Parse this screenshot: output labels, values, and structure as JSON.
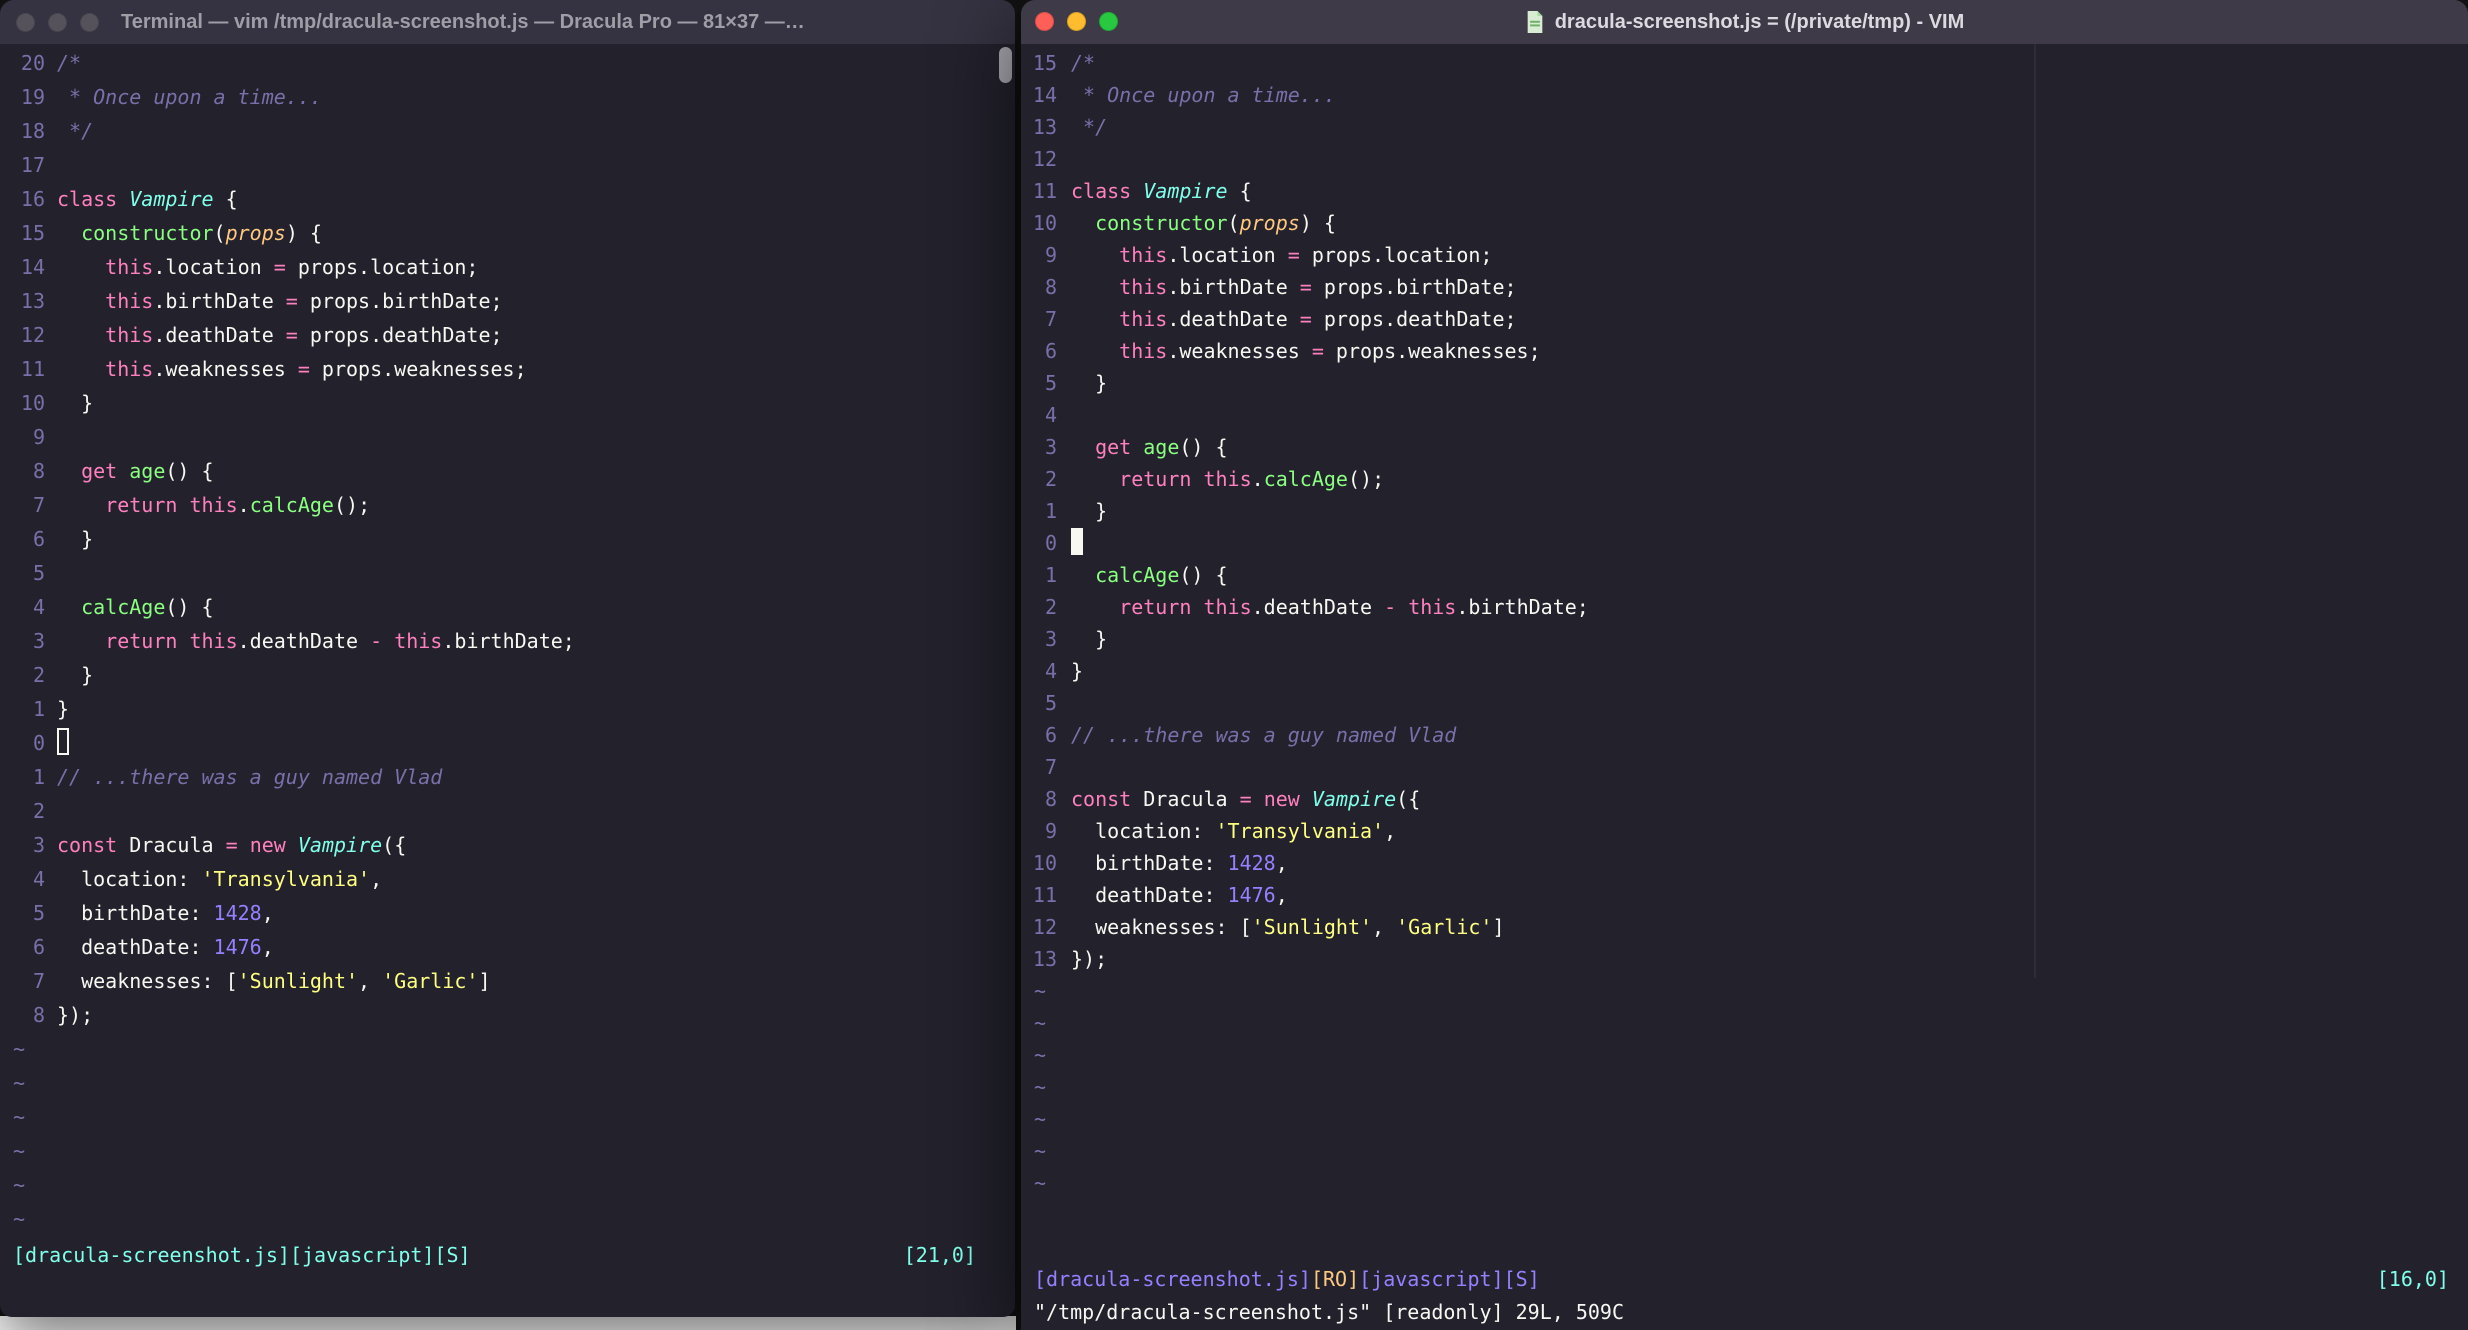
{
  "palette": {
    "bg": "#22212C",
    "fg": "#F8F8F2",
    "comment": "#7970A9",
    "linenr": "#7970A9",
    "pink": "#FF80BF",
    "green": "#8AFF80",
    "cyan": "#80FFEA",
    "orange": "#FFCA80",
    "purple": "#9580FF",
    "yellow": "#FFFF80",
    "titlebar_left": "#353241",
    "titlebar_right": "#3E3A47",
    "title_text_left": "#9F9DA6",
    "title_text_right": "#DCDAE0",
    "light_red": "#FF5F57",
    "light_yellow": "#FEBC2E",
    "light_green": "#28C840",
    "light_inactive": "#55525C"
  },
  "tilde_char": "~",
  "left_window": {
    "title": "Terminal — vim /tmp/dracula-screenshot.js — Dracula Pro — 81×37 —…",
    "status": {
      "left_text": "[dracula-screenshot.js][javascript][S]",
      "right_text": "[21,0]"
    },
    "cursor_line_index": 20,
    "cursor_style": "hollow",
    "tilde_count": 6,
    "lines": [
      {
        "n": "20",
        "t": [
          [
            "com",
            "/*"
          ]
        ]
      },
      {
        "n": "19",
        "t": [
          [
            "com",
            " * Once upon a time..."
          ]
        ]
      },
      {
        "n": "18",
        "t": [
          [
            "com",
            " */"
          ]
        ]
      },
      {
        "n": "17",
        "t": []
      },
      {
        "n": "16",
        "t": [
          [
            "kw",
            "class"
          ],
          [
            "fg",
            " "
          ],
          [
            "cls",
            "Vampire"
          ],
          [
            "fg",
            " {"
          ]
        ]
      },
      {
        "n": "15",
        "t": [
          [
            "fg",
            "  "
          ],
          [
            "fn",
            "constructor"
          ],
          [
            "fg",
            "("
          ],
          [
            "param",
            "props"
          ],
          [
            "fg",
            ") {"
          ]
        ]
      },
      {
        "n": "14",
        "t": [
          [
            "fg",
            "    "
          ],
          [
            "kw",
            "this"
          ],
          [
            "fg",
            ".location "
          ],
          [
            "op",
            "="
          ],
          [
            "fg",
            " props.location;"
          ]
        ]
      },
      {
        "n": "13",
        "t": [
          [
            "fg",
            "    "
          ],
          [
            "kw",
            "this"
          ],
          [
            "fg",
            ".birthDate "
          ],
          [
            "op",
            "="
          ],
          [
            "fg",
            " props.birthDate;"
          ]
        ]
      },
      {
        "n": "12",
        "t": [
          [
            "fg",
            "    "
          ],
          [
            "kw",
            "this"
          ],
          [
            "fg",
            ".deathDate "
          ],
          [
            "op",
            "="
          ],
          [
            "fg",
            " props.deathDate;"
          ]
        ]
      },
      {
        "n": "11",
        "t": [
          [
            "fg",
            "    "
          ],
          [
            "kw",
            "this"
          ],
          [
            "fg",
            ".weaknesses "
          ],
          [
            "op",
            "="
          ],
          [
            "fg",
            " props.weaknesses;"
          ]
        ]
      },
      {
        "n": "10",
        "t": [
          [
            "fg",
            "  }"
          ]
        ]
      },
      {
        "n": "9",
        "t": []
      },
      {
        "n": "8",
        "t": [
          [
            "fg",
            "  "
          ],
          [
            "kw",
            "get"
          ],
          [
            "fg",
            " "
          ],
          [
            "fn",
            "age"
          ],
          [
            "fg",
            "() {"
          ]
        ]
      },
      {
        "n": "7",
        "t": [
          [
            "fg",
            "    "
          ],
          [
            "kw",
            "return"
          ],
          [
            "fg",
            " "
          ],
          [
            "kw",
            "this"
          ],
          [
            "fg",
            "."
          ],
          [
            "fn",
            "calcAge"
          ],
          [
            "fg",
            "();"
          ]
        ]
      },
      {
        "n": "6",
        "t": [
          [
            "fg",
            "  }"
          ]
        ]
      },
      {
        "n": "5",
        "t": []
      },
      {
        "n": "4",
        "t": [
          [
            "fg",
            "  "
          ],
          [
            "fn",
            "calcAge"
          ],
          [
            "fg",
            "() {"
          ]
        ]
      },
      {
        "n": "3",
        "t": [
          [
            "fg",
            "    "
          ],
          [
            "kw",
            "return"
          ],
          [
            "fg",
            " "
          ],
          [
            "kw",
            "this"
          ],
          [
            "fg",
            ".deathDate "
          ],
          [
            "op",
            "-"
          ],
          [
            "fg",
            " "
          ],
          [
            "kw",
            "this"
          ],
          [
            "fg",
            ".birthDate;"
          ]
        ]
      },
      {
        "n": "2",
        "t": [
          [
            "fg",
            "  }"
          ]
        ]
      },
      {
        "n": "1",
        "t": [
          [
            "fg",
            "}"
          ]
        ]
      },
      {
        "n": "0",
        "t": []
      },
      {
        "n": "1",
        "t": [
          [
            "com",
            "// ...there was a guy named Vlad"
          ]
        ]
      },
      {
        "n": "2",
        "t": []
      },
      {
        "n": "3",
        "t": [
          [
            "kw",
            "const"
          ],
          [
            "fg",
            " Dracula "
          ],
          [
            "op",
            "="
          ],
          [
            "fg",
            " "
          ],
          [
            "kw",
            "new"
          ],
          [
            "fg",
            " "
          ],
          [
            "cls",
            "Vampire"
          ],
          [
            "fg",
            "({"
          ]
        ]
      },
      {
        "n": "4",
        "t": [
          [
            "fg",
            "  location: "
          ],
          [
            "str",
            "'Transylvania'"
          ],
          [
            "fg",
            ","
          ]
        ]
      },
      {
        "n": "5",
        "t": [
          [
            "fg",
            "  birthDate: "
          ],
          [
            "num",
            "1428"
          ],
          [
            "fg",
            ","
          ]
        ]
      },
      {
        "n": "6",
        "t": [
          [
            "fg",
            "  deathDate: "
          ],
          [
            "num",
            "1476"
          ],
          [
            "fg",
            ","
          ]
        ]
      },
      {
        "n": "7",
        "t": [
          [
            "fg",
            "  weaknesses: ["
          ],
          [
            "str",
            "'Sunlight'"
          ],
          [
            "fg",
            ", "
          ],
          [
            "str",
            "'Garlic'"
          ],
          [
            "fg",
            "]"
          ]
        ]
      },
      {
        "n": "8",
        "t": [
          [
            "fg",
            "});"
          ]
        ]
      }
    ]
  },
  "right_window": {
    "title": "dracula-screenshot.js = (/private/tmp) - VIM",
    "title_icon": "document",
    "status": {
      "segments": [
        {
          "color": "purple",
          "text": "[dracula-screenshot.js]"
        },
        {
          "color": "orange",
          "text": "[RO]"
        },
        {
          "color": "purple",
          "text": "[javascript][S]"
        }
      ],
      "right_text": "[16,0]"
    },
    "cmdline": "\"/tmp/dracula-screenshot.js\" [readonly] 29L, 509C",
    "cursor_line_index": 15,
    "cursor_style": "block",
    "tilde_count": 7,
    "lines": [
      {
        "n": "15",
        "t": [
          [
            "com",
            "/*"
          ]
        ]
      },
      {
        "n": "14",
        "t": [
          [
            "com",
            " * Once upon a time..."
          ]
        ]
      },
      {
        "n": "13",
        "t": [
          [
            "com",
            " */"
          ]
        ]
      },
      {
        "n": "12",
        "t": []
      },
      {
        "n": "11",
        "t": [
          [
            "kw",
            "class"
          ],
          [
            "fg",
            " "
          ],
          [
            "cls",
            "Vampire"
          ],
          [
            "fg",
            " {"
          ]
        ]
      },
      {
        "n": "10",
        "t": [
          [
            "fg",
            "  "
          ],
          [
            "fn",
            "constructor"
          ],
          [
            "fg",
            "("
          ],
          [
            "param",
            "props"
          ],
          [
            "fg",
            ") {"
          ]
        ]
      },
      {
        "n": "9",
        "t": [
          [
            "fg",
            "    "
          ],
          [
            "kw",
            "this"
          ],
          [
            "fg",
            ".location "
          ],
          [
            "op",
            "="
          ],
          [
            "fg",
            " props.location;"
          ]
        ]
      },
      {
        "n": "8",
        "t": [
          [
            "fg",
            "    "
          ],
          [
            "kw",
            "this"
          ],
          [
            "fg",
            ".birthDate "
          ],
          [
            "op",
            "="
          ],
          [
            "fg",
            " props.birthDate;"
          ]
        ]
      },
      {
        "n": "7",
        "t": [
          [
            "fg",
            "    "
          ],
          [
            "kw",
            "this"
          ],
          [
            "fg",
            ".deathDate "
          ],
          [
            "op",
            "="
          ],
          [
            "fg",
            " props.deathDate;"
          ]
        ]
      },
      {
        "n": "6",
        "t": [
          [
            "fg",
            "    "
          ],
          [
            "kw",
            "this"
          ],
          [
            "fg",
            ".weaknesses "
          ],
          [
            "op",
            "="
          ],
          [
            "fg",
            " props.weaknesses;"
          ]
        ]
      },
      {
        "n": "5",
        "t": [
          [
            "fg",
            "  }"
          ]
        ]
      },
      {
        "n": "4",
        "t": []
      },
      {
        "n": "3",
        "t": [
          [
            "fg",
            "  "
          ],
          [
            "kw",
            "get"
          ],
          [
            "fg",
            " "
          ],
          [
            "fn",
            "age"
          ],
          [
            "fg",
            "() {"
          ]
        ]
      },
      {
        "n": "2",
        "t": [
          [
            "fg",
            "    "
          ],
          [
            "kw",
            "return"
          ],
          [
            "fg",
            " "
          ],
          [
            "kw",
            "this"
          ],
          [
            "fg",
            "."
          ],
          [
            "fn",
            "calcAge"
          ],
          [
            "fg",
            "();"
          ]
        ]
      },
      {
        "n": "1",
        "t": [
          [
            "fg",
            "  }"
          ]
        ]
      },
      {
        "n": "0",
        "t": []
      },
      {
        "n": "1",
        "t": [
          [
            "fg",
            "  "
          ],
          [
            "fn",
            "calcAge"
          ],
          [
            "fg",
            "() {"
          ]
        ]
      },
      {
        "n": "2",
        "t": [
          [
            "fg",
            "    "
          ],
          [
            "kw",
            "return"
          ],
          [
            "fg",
            " "
          ],
          [
            "kw",
            "this"
          ],
          [
            "fg",
            ".deathDate "
          ],
          [
            "op",
            "-"
          ],
          [
            "fg",
            " "
          ],
          [
            "kw",
            "this"
          ],
          [
            "fg",
            ".birthDate;"
          ]
        ]
      },
      {
        "n": "3",
        "t": [
          [
            "fg",
            "  }"
          ]
        ]
      },
      {
        "n": "4",
        "t": [
          [
            "fg",
            "}"
          ]
        ]
      },
      {
        "n": "5",
        "t": []
      },
      {
        "n": "6",
        "t": [
          [
            "com",
            "// ...there was a guy named Vlad"
          ]
        ]
      },
      {
        "n": "7",
        "t": []
      },
      {
        "n": "8",
        "t": [
          [
            "kw",
            "const"
          ],
          [
            "fg",
            " Dracula "
          ],
          [
            "op",
            "="
          ],
          [
            "fg",
            " "
          ],
          [
            "kw",
            "new"
          ],
          [
            "fg",
            " "
          ],
          [
            "cls",
            "Vampire"
          ],
          [
            "fg",
            "({"
          ]
        ]
      },
      {
        "n": "9",
        "t": [
          [
            "fg",
            "  location: "
          ],
          [
            "str",
            "'Transylvania'"
          ],
          [
            "fg",
            ","
          ]
        ]
      },
      {
        "n": "10",
        "t": [
          [
            "fg",
            "  birthDate: "
          ],
          [
            "num",
            "1428"
          ],
          [
            "fg",
            ","
          ]
        ]
      },
      {
        "n": "11",
        "t": [
          [
            "fg",
            "  deathDate: "
          ],
          [
            "num",
            "1476"
          ],
          [
            "fg",
            ","
          ]
        ]
      },
      {
        "n": "12",
        "t": [
          [
            "fg",
            "  weaknesses: ["
          ],
          [
            "str",
            "'Sunlight'"
          ],
          [
            "fg",
            ", "
          ],
          [
            "str",
            "'Garlic'"
          ],
          [
            "fg",
            "]"
          ]
        ]
      },
      {
        "n": "13",
        "t": [
          [
            "fg",
            "});"
          ]
        ]
      }
    ]
  }
}
